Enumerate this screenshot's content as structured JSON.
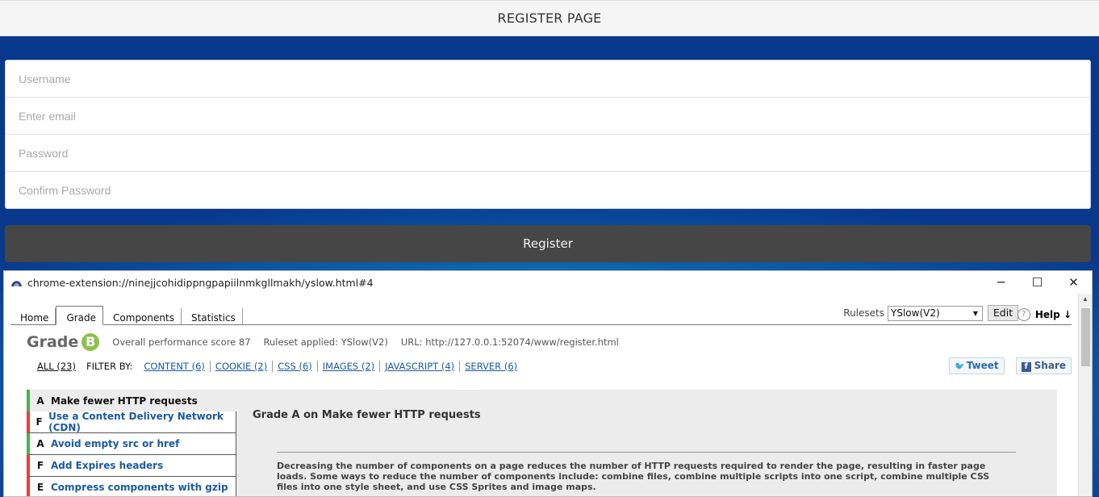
{
  "header": {
    "title": "REGISTER PAGE"
  },
  "form": {
    "username_placeholder": "Username",
    "email_placeholder": "Enter email",
    "password_placeholder": "Password",
    "confirm_placeholder": "Confirm Password",
    "register_label": "Register"
  },
  "ext_window": {
    "title": "chrome-extension://ninejjcohidippngpapiilnmkgllmakh/yslow.html#4",
    "minimize": "─",
    "maximize": "☐",
    "close": "✕"
  },
  "yslow": {
    "tabs": [
      "Home",
      "Grade",
      "Components",
      "Statistics"
    ],
    "active_tab": "Grade",
    "rulesets_label": "Rulesets",
    "ruleset_selected": "YSlow(V2)",
    "edit_label": "Edit",
    "help_label": "Help ↓",
    "grade_title": "Grade",
    "grade_letter": "B",
    "overall_score": "Overall performance score 87",
    "ruleset_applied": "Ruleset applied: YSlow(V2)",
    "url": "URL: http://127.0.0.1:52074/www/register.html",
    "filter_all": "ALL (23)",
    "filter_by": "FILTER BY:",
    "filters": [
      "CONTENT (6)",
      "COOKIE (2)",
      "CSS (6)",
      "IMAGES (2)",
      "JAVASCRIPT (4)",
      "SERVER (6)"
    ],
    "tweet_label": "Tweet",
    "share_label": "Share",
    "rules": [
      {
        "grade": "A",
        "title": "Make fewer HTTP requests"
      },
      {
        "grade": "F",
        "title": "Use a Content Delivery Network (CDN)"
      },
      {
        "grade": "A",
        "title": "Avoid empty src or href"
      },
      {
        "grade": "F",
        "title": "Add Expires headers"
      },
      {
        "grade": "E",
        "title": "Compress components with gzip"
      }
    ],
    "detail_title": "Grade A on Make fewer HTTP requests",
    "detail_text": "Decreasing the number of components on a page reduces the number of HTTP requests required to render the page, resulting in faster page loads. Some ways to reduce the number of components include: combine files, combine multiple scripts into one script, combine multiple CSS files into one style sheet, and use CSS Sprites and image maps."
  },
  "colors": {
    "grade_b": "#8bc34a",
    "grade_a": "#4caf50",
    "grade_f": "#e84040",
    "link": "#1a5aa4",
    "register_bg": "#464646"
  }
}
